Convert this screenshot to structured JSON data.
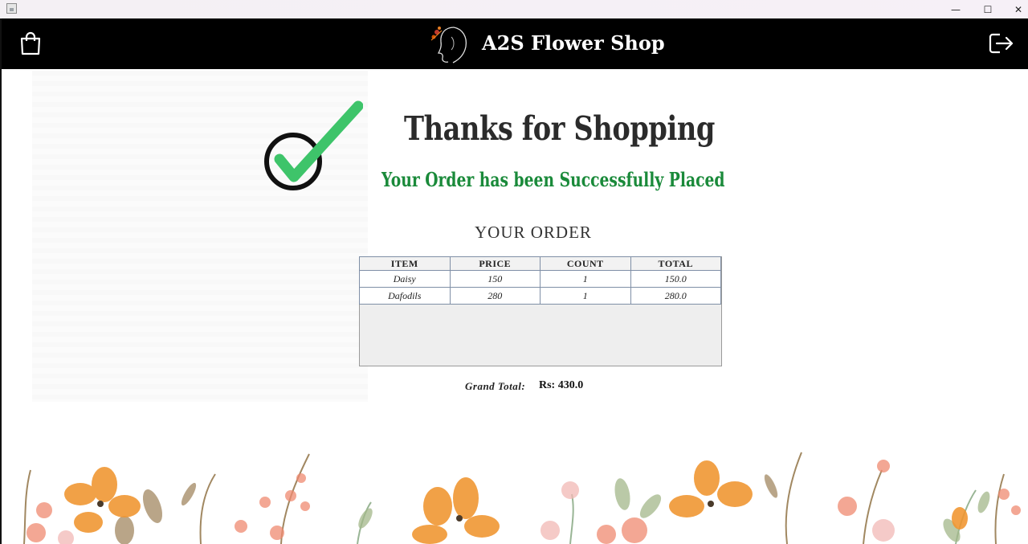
{
  "window": {
    "minimize": "—",
    "maximize": "☐",
    "close": "✕"
  },
  "header": {
    "title": "A2S Flower Shop"
  },
  "confirmation": {
    "heading": "Thanks for Shopping",
    "subheading": "Your Order has been Successfully Placed"
  },
  "order": {
    "title": "YOUR ORDER",
    "columns": [
      "ITEM",
      "PRICE",
      "COUNT",
      "TOTAL"
    ],
    "rows": [
      [
        "Daisy",
        "150",
        "1",
        "150.0"
      ],
      [
        "Dafodils",
        "280",
        "1",
        "280.0"
      ]
    ],
    "grand_total_label": "Grand Total:",
    "grand_total_value": "Rs: 430.0"
  },
  "icons": {
    "cart": "shopping-bag-icon",
    "logout": "logout-icon",
    "logo": "woman-silhouette-logo",
    "check": "check-icon"
  },
  "colors": {
    "header_bg": "#000000",
    "success_green": "#1a8a3a",
    "check_green": "#3ec46a"
  }
}
